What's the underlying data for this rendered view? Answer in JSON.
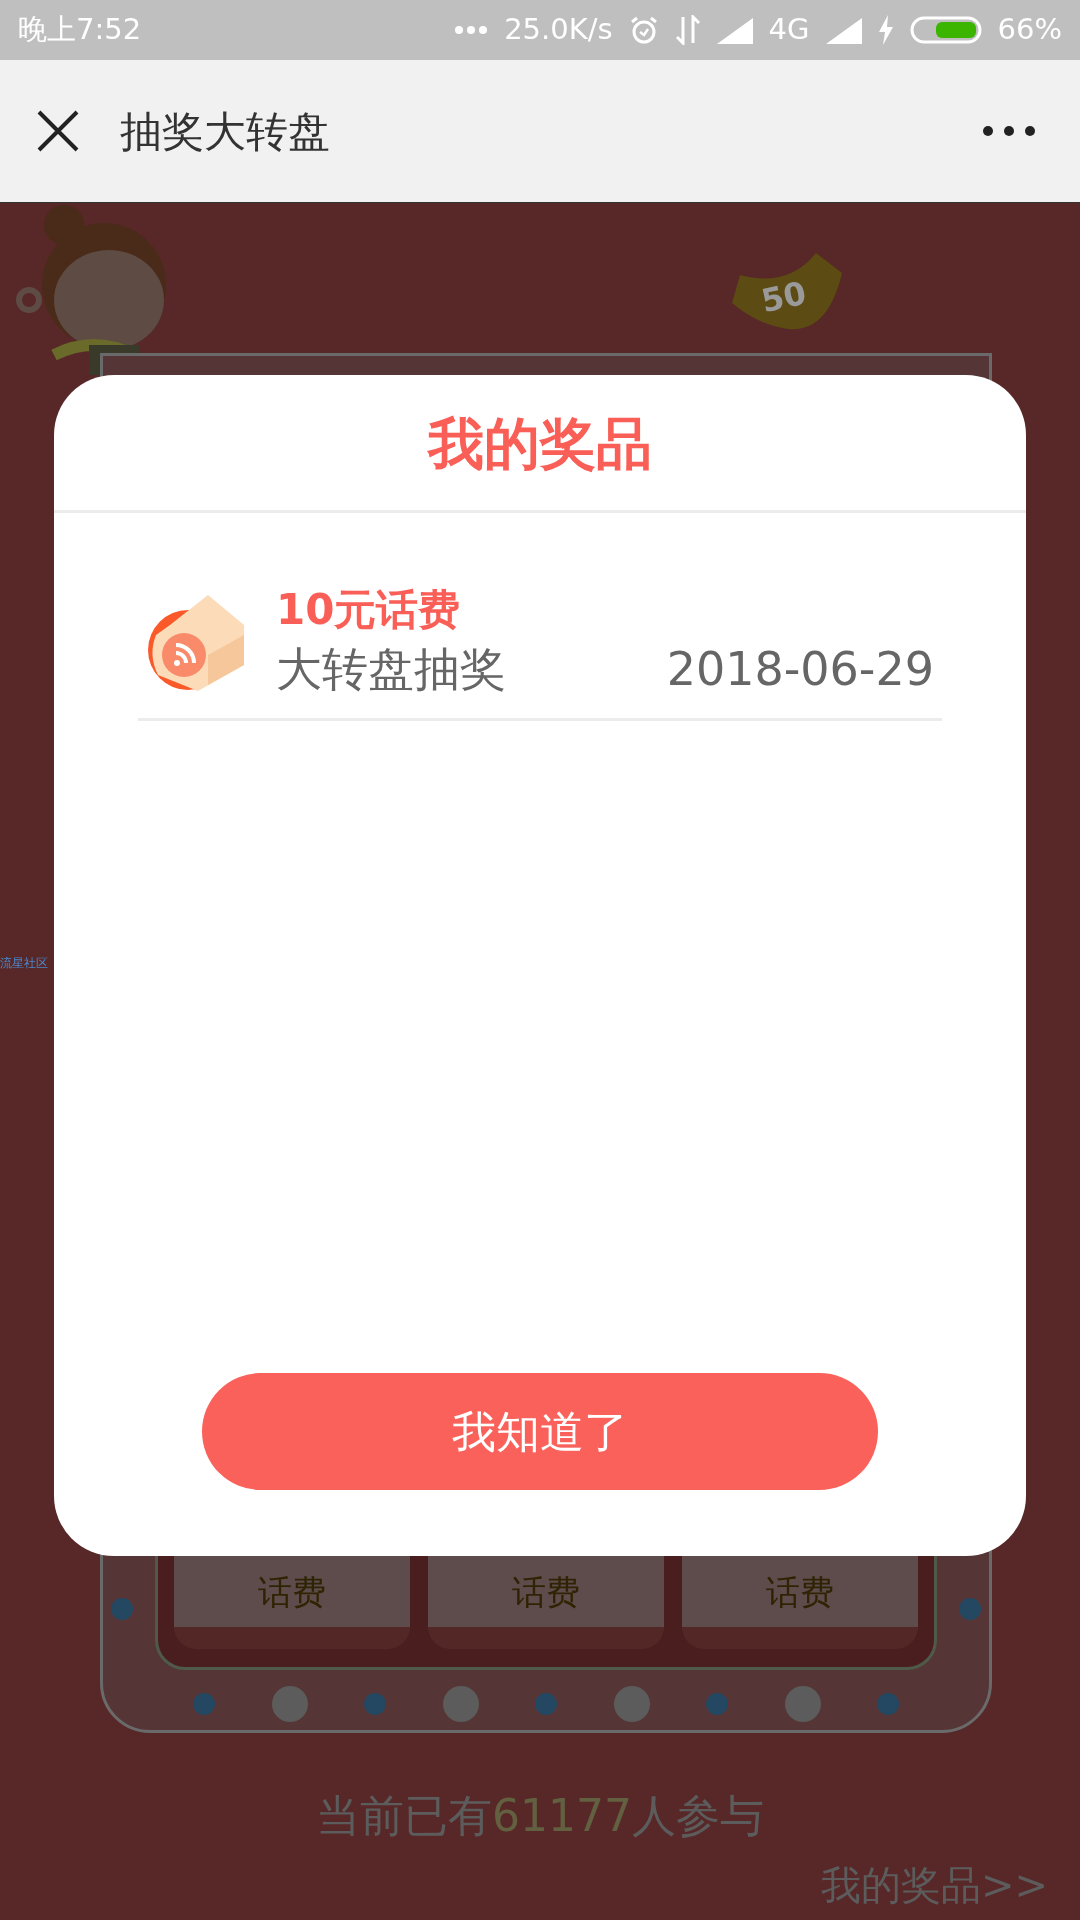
{
  "status_bar": {
    "time": "晚上7:52",
    "network_speed": "25.0K/s",
    "network_type": "4G",
    "battery": "66%"
  },
  "nav": {
    "title": "抽奖大转盘"
  },
  "background": {
    "banner_label": "50",
    "side_link": "流星社区",
    "prize_cells": [
      {
        "label": "话费"
      },
      {
        "label": "话费"
      },
      {
        "label": "话费"
      }
    ],
    "participants": {
      "prefix": "当前已有",
      "count": "61177",
      "suffix": "人参与"
    },
    "my_prizes_link": "我的奖品>>"
  },
  "dialog": {
    "title": "我的奖品",
    "prizes": [
      {
        "name": "10元话费",
        "source": "大转盘抽奖",
        "date": "2018-06-29"
      }
    ],
    "confirm_button": "我知道了"
  }
}
